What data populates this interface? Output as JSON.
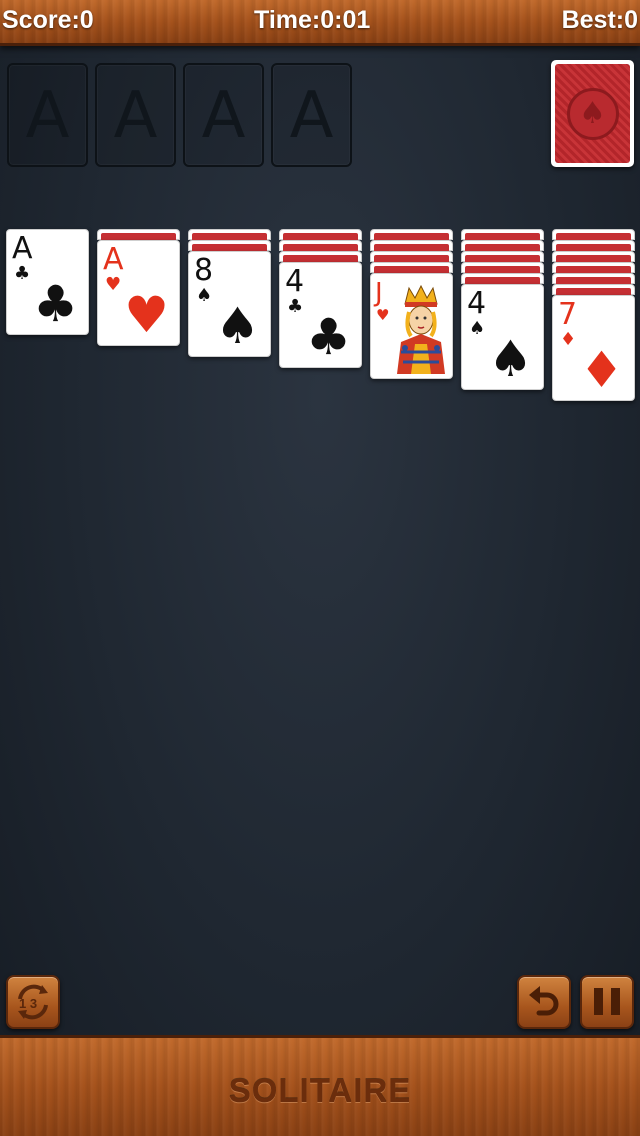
{
  "header": {
    "score_label": "Score:0",
    "time_label": "Time:0:01",
    "best_label": "Best:0"
  },
  "foundations": [
    {
      "placeholder": "A"
    },
    {
      "placeholder": "A"
    },
    {
      "placeholder": "A"
    },
    {
      "placeholder": "A"
    }
  ],
  "stock": {
    "back_symbol": "♠"
  },
  "tableau": [
    {
      "hidden": 0,
      "top_card": {
        "rank": "A",
        "suit": "♣",
        "color": "black"
      }
    },
    {
      "hidden": 1,
      "top_card": {
        "rank": "A",
        "suit": "♥",
        "color": "red"
      }
    },
    {
      "hidden": 2,
      "top_card": {
        "rank": "8",
        "suit": "♠",
        "color": "black"
      }
    },
    {
      "hidden": 3,
      "top_card": {
        "rank": "4",
        "suit": "♣",
        "color": "black"
      }
    },
    {
      "hidden": 4,
      "top_card": {
        "rank": "J",
        "suit": "♥",
        "color": "red",
        "face": true
      }
    },
    {
      "hidden": 5,
      "top_card": {
        "rank": "4",
        "suit": "♠",
        "color": "black"
      }
    },
    {
      "hidden": 6,
      "top_card": {
        "rank": "7",
        "suit": "♦",
        "color": "red"
      }
    }
  ],
  "buttons": {
    "deal_mode": "1 3",
    "undo_icon": "undo-arrow",
    "pause_icon": "pause"
  },
  "footer": {
    "title": "SOLITAIRE"
  },
  "colors": {
    "felt": "#1f2731",
    "wood": "#a5521c",
    "card_back": "#c52f33",
    "red_suit": "#e4321c"
  }
}
